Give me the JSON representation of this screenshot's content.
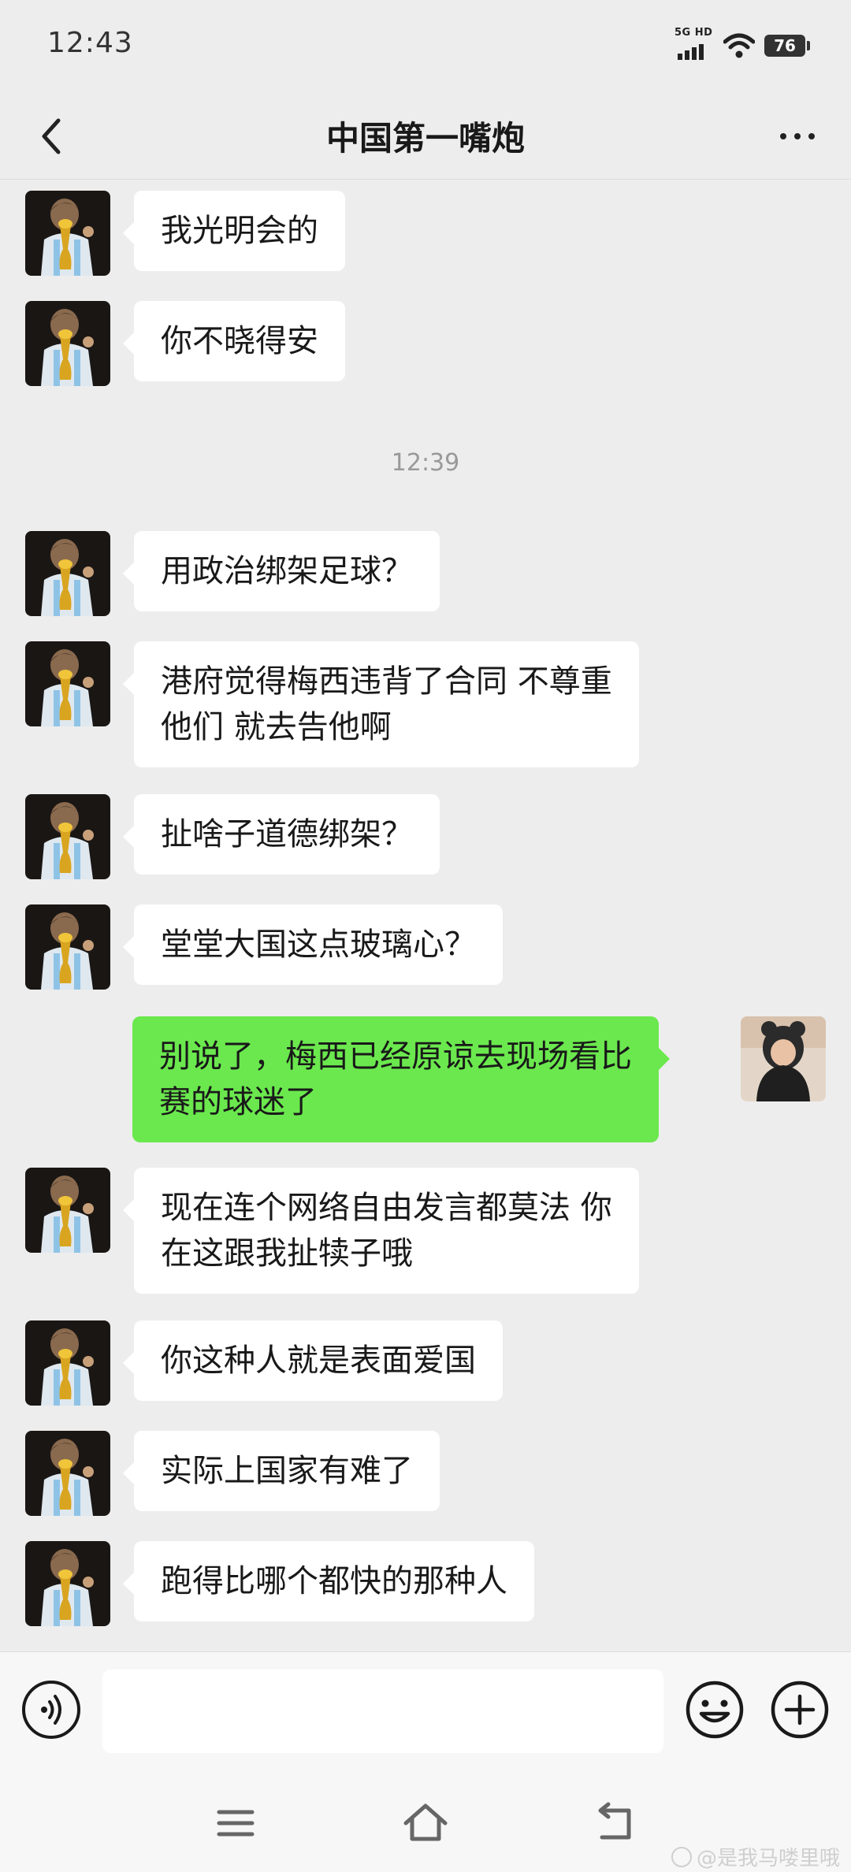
{
  "status_bar": {
    "time": "12:43",
    "network_label": "5G HD",
    "battery_level": "76",
    "icons": [
      "signal-icon",
      "wifi-icon",
      "battery-icon"
    ]
  },
  "nav": {
    "title": "中国第一嘴炮",
    "back_icon": "chevron-left-icon",
    "more_icon": "more-dots-icon"
  },
  "messages": [
    {
      "side": "left",
      "lines": [
        "我光明会的"
      ]
    },
    {
      "side": "left",
      "lines": [
        "你不晓得安"
      ]
    },
    {
      "timestamp": "12:39"
    },
    {
      "side": "left",
      "lines": [
        "用政治绑架足球？"
      ]
    },
    {
      "side": "left",
      "lines": [
        "港府觉得梅西违背了合同 不尊重",
        "他们 就去告他啊"
      ]
    },
    {
      "side": "left",
      "lines": [
        "扯啥子道德绑架？"
      ]
    },
    {
      "side": "left",
      "lines": [
        "堂堂大国这点玻璃心？"
      ]
    },
    {
      "side": "right",
      "lines": [
        "别说了，梅西已经原谅去现场看比",
        "赛的球迷了"
      ]
    },
    {
      "side": "left",
      "lines": [
        "现在连个网络自由发言都莫法 你",
        "在这跟我扯犊子哦"
      ]
    },
    {
      "side": "left",
      "lines": [
        "你这种人就是表面爱国"
      ]
    },
    {
      "side": "left",
      "lines": [
        "实际上国家有难了"
      ]
    },
    {
      "side": "left",
      "lines": [
        "跑得比哪个都快的那种人"
      ]
    }
  ],
  "input_bar": {
    "placeholder": "",
    "voice_icon": "voice-icon",
    "emoji_icon": "emoji-icon",
    "plus_icon": "plus-icon"
  },
  "system_nav": {
    "icons": [
      "menu-icon",
      "home-icon",
      "back-icon"
    ]
  },
  "watermark": "@是我马喽里哦",
  "colors": {
    "background": "#ededed",
    "self_bubble": "#6be84e",
    "other_bubble": "#ffffff"
  }
}
